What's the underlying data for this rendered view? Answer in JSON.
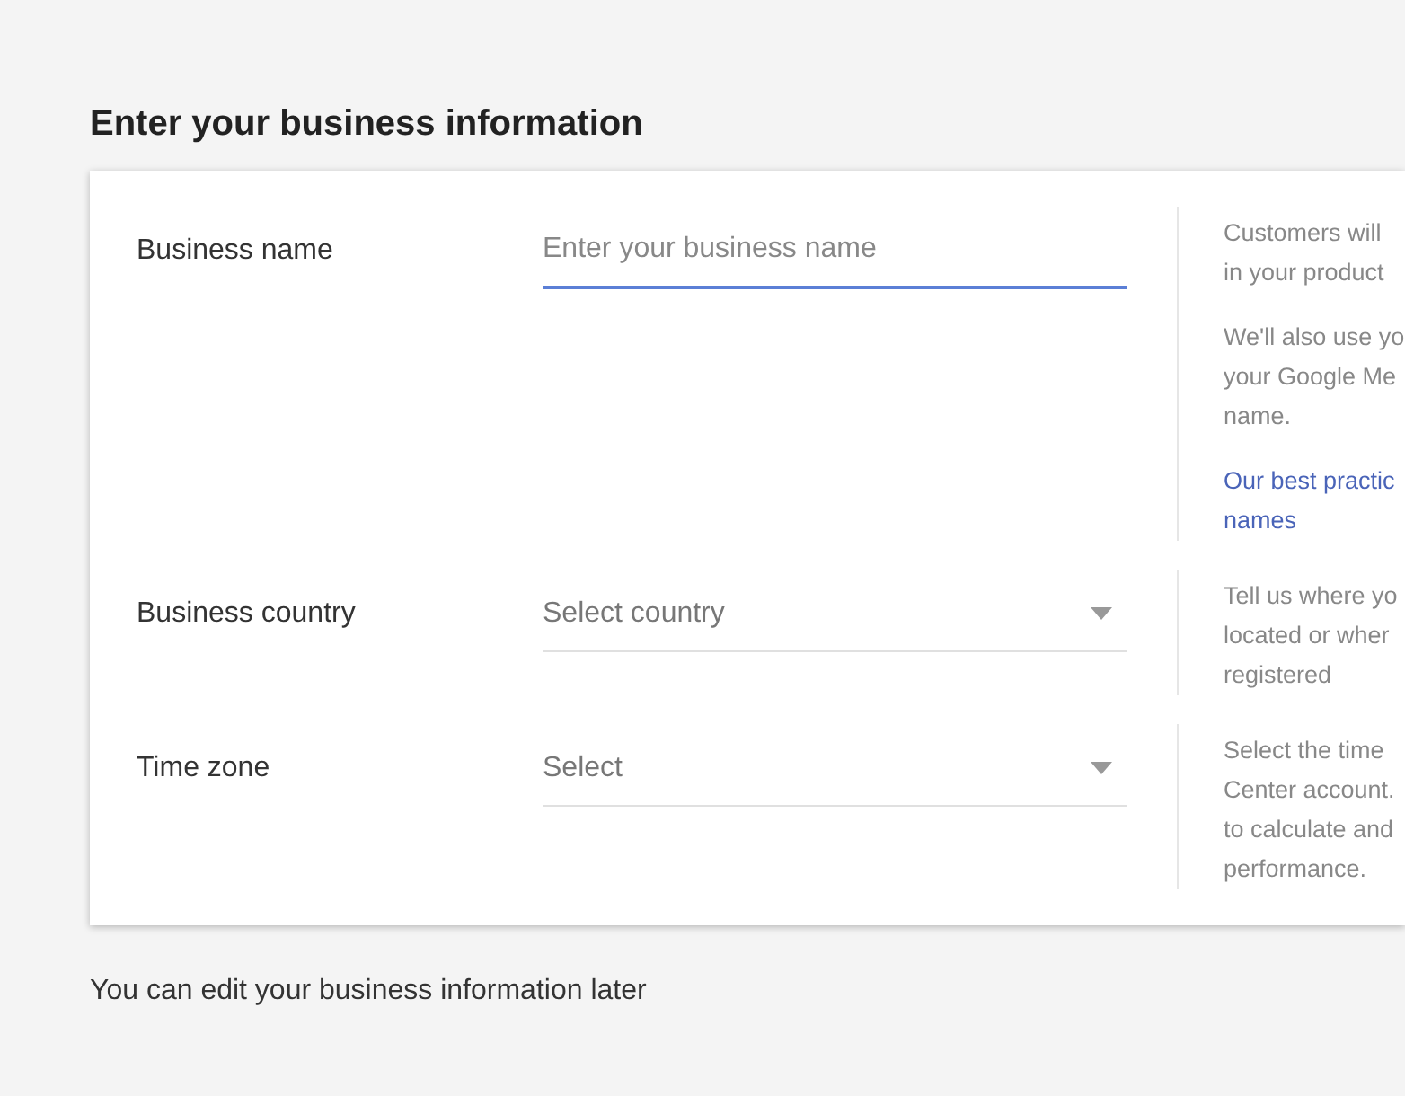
{
  "heading": "Enter your business information",
  "rows": [
    {
      "label": "Business name",
      "field": {
        "kind": "text",
        "placeholder": "Enter your business name",
        "focused": true
      },
      "hints": [
        {
          "kind": "text",
          "lines": [
            "Customers will",
            "in your product"
          ]
        },
        {
          "kind": "text",
          "lines": [
            "We'll also use yo",
            "your Google Me",
            "name."
          ]
        },
        {
          "kind": "link",
          "lines": [
            "Our best practic",
            "names"
          ]
        }
      ]
    },
    {
      "label": "Business country",
      "field": {
        "kind": "select",
        "placeholder": "Select country",
        "focused": false
      },
      "hints": [
        {
          "kind": "text",
          "lines": [
            "Tell us where yo",
            "located or wher",
            "registered"
          ]
        }
      ]
    },
    {
      "label": "Time zone",
      "field": {
        "kind": "select",
        "placeholder": "Select",
        "focused": false
      },
      "hints": [
        {
          "kind": "text",
          "lines": [
            "Select the time",
            "Center account.",
            "to calculate and",
            "performance."
          ]
        }
      ]
    }
  ],
  "footer": "You can edit your business information later"
}
